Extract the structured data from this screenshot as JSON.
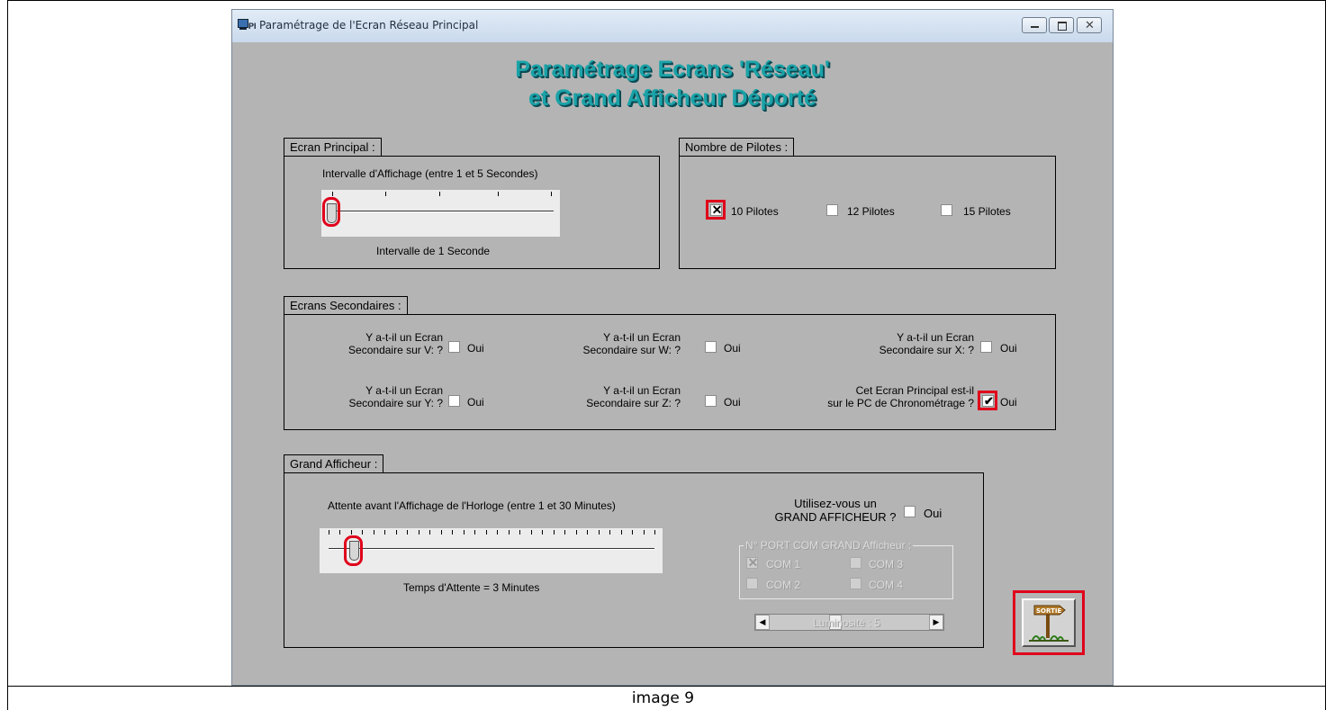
{
  "window": {
    "title": "Paramétrage de l'Ecran Réseau Principal",
    "heading_line1": "Paramétrage Ecrans 'Réseau'",
    "heading_line2": "et Grand Afficheur Déporté"
  },
  "ecran_principal": {
    "label": "Ecran Principal :",
    "slider_label": "Intervalle d'Affichage  (entre 1 et 5 Secondes)",
    "slider_value": 1,
    "slider_min": 1,
    "slider_max": 5,
    "value_text": "Intervalle de 1 Seconde"
  },
  "pilotes": {
    "label": "Nombre de Pilotes :",
    "options": [
      {
        "label": "10 Pilotes",
        "checked": true
      },
      {
        "label": "12 Pilotes",
        "checked": false
      },
      {
        "label": "15 Pilotes",
        "checked": false
      }
    ]
  },
  "secondaires": {
    "label": "Ecrans Secondaires :",
    "oui": "Oui",
    "items": [
      {
        "line1": "Y a-t-il un Ecran",
        "line2": "Secondaire sur V: ?",
        "checked": false
      },
      {
        "line1": "Y a-t-il un Ecran",
        "line2": "Secondaire sur W: ?",
        "checked": false
      },
      {
        "line1": "Y a-t-il un Ecran",
        "line2": "Secondaire sur X: ?",
        "checked": false
      },
      {
        "line1": "Y a-t-il un Ecran",
        "line2": "Secondaire sur Y: ?",
        "checked": false
      },
      {
        "line1": "Y a-t-il un Ecran",
        "line2": "Secondaire sur Z: ?",
        "checked": false
      },
      {
        "line1": "Cet Ecran Principal est-il",
        "line2": "sur le PC de Chronométrage ?",
        "checked": true
      }
    ]
  },
  "grand_afficheur": {
    "label": "Grand Afficheur :",
    "slider_label": "Attente avant l'Affichage de l'Horloge (entre 1 et 30 Minutes)",
    "slider_value": 3,
    "slider_min": 1,
    "slider_max": 30,
    "value_text": "Temps d'Attente = 3 Minutes",
    "question_line1": "Utilisez-vous un",
    "question_line2": "GRAND AFFICHEUR ?",
    "oui": "Oui",
    "uses_display": false,
    "port_label": "N° PORT COM GRAND Afficheur :",
    "ports": [
      {
        "label": "COM 1",
        "checked": true
      },
      {
        "label": "COM 3",
        "checked": false
      },
      {
        "label": "COM 2",
        "checked": false
      },
      {
        "label": "COM 4",
        "checked": false
      }
    ],
    "luminosite": "Luminosité : 5",
    "luminosite_value": 5
  },
  "exit_button": {
    "sign_text": "SORTIE"
  },
  "caption": "image 9",
  "colors": {
    "heading": "#19a3a8",
    "highlight": "#e0001b",
    "window_bg": "#b4b4b4"
  }
}
